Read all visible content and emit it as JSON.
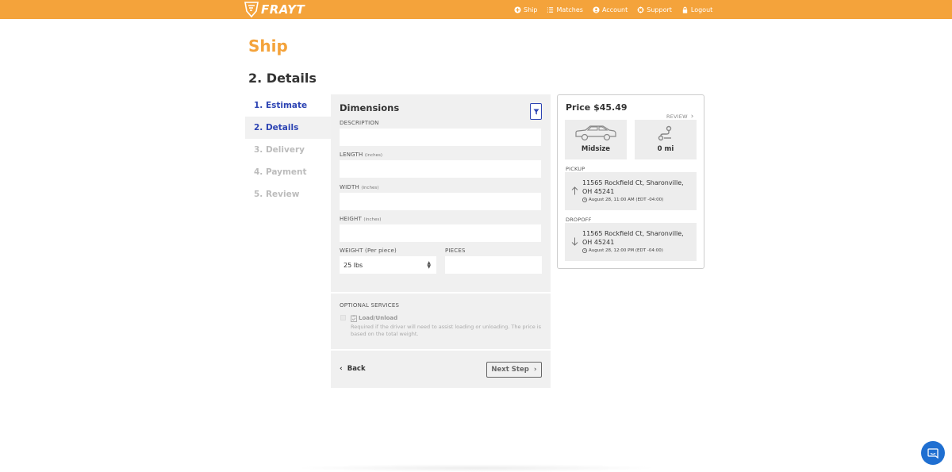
{
  "brand": {
    "name": "FRAYT",
    "color": "#f4a33b",
    "accent": "#2d44b3"
  },
  "nav": [
    {
      "label": "Ship",
      "icon": "plus-circle-icon"
    },
    {
      "label": "Matches",
      "icon": "list-icon"
    },
    {
      "label": "Account",
      "icon": "user-circle-icon"
    },
    {
      "label": "Support",
      "icon": "lifebuoy-icon"
    },
    {
      "label": "Logout",
      "icon": "lock-icon"
    }
  ],
  "page": {
    "title": "Ship",
    "section": "2. Details"
  },
  "steps": [
    {
      "label": "1. Estimate",
      "state": "done"
    },
    {
      "label": "2. Details",
      "state": "active"
    },
    {
      "label": "3. Delivery",
      "state": "pending"
    },
    {
      "label": "4. Payment",
      "state": "pending"
    },
    {
      "label": "5. Review",
      "state": "pending"
    }
  ],
  "form": {
    "title": "Dimensions",
    "description_label": "DESCRIPTION",
    "description_value": "",
    "length_label": "LENGTH",
    "length_unit": "(inches)",
    "length_value": "",
    "width_label": "WIDTH",
    "width_unit": "(inches)",
    "width_value": "",
    "height_label": "HEIGHT",
    "height_unit": "(inches)",
    "height_value": "",
    "weight_label": "WEIGHT",
    "weight_unit": "(Per piece)",
    "weight_value": "25 lbs",
    "pieces_label": "PIECES",
    "pieces_value": ""
  },
  "services": {
    "title": "OPTIONAL SERVICES",
    "items": [
      {
        "name": "Load/Unload",
        "description": "Required if the driver will need to assist loading or unloading. The price is based on the total weight.",
        "checked": false
      }
    ]
  },
  "actions": {
    "back": "Back",
    "next": "Next Step"
  },
  "summary": {
    "price": "Price $45.49",
    "review": "REVIEW",
    "vehicle": "Midsize",
    "distance": "0 mi",
    "pickup_label": "PICKUP",
    "pickup_address": "11565 Rockfield Ct, Sharonville, OH 45241",
    "pickup_time": "August 28, 11:00 AM (EDT -04:00)",
    "dropoff_label": "DROPOFF",
    "dropoff_address": "11565 Rockfield Ct, Sharonville, OH 45241",
    "dropoff_time": "August 28, 12:00 PM (EDT -04:00)"
  }
}
